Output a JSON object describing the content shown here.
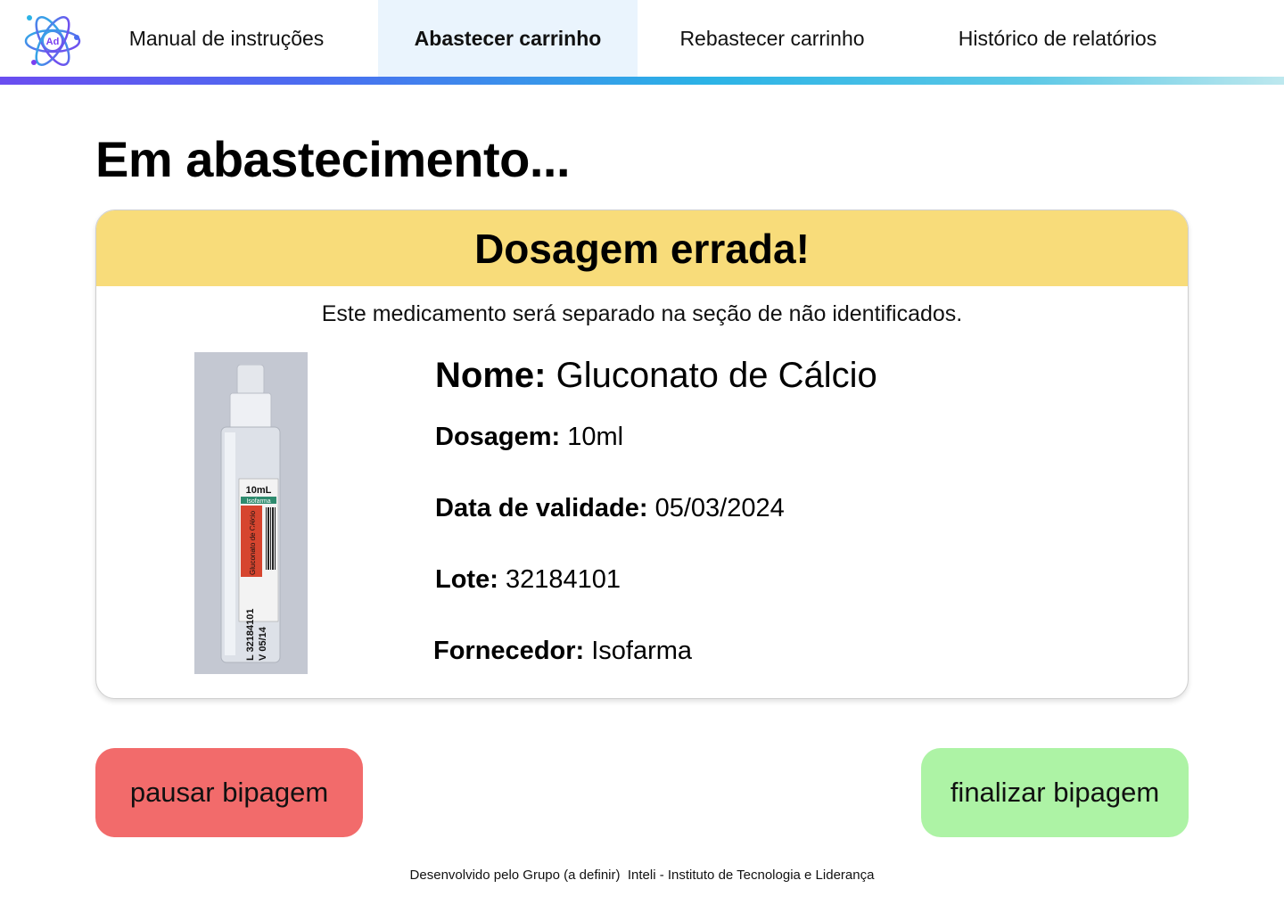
{
  "nav": {
    "logo_text": "Ad",
    "items": [
      {
        "label": "Manual de instruções",
        "active": false
      },
      {
        "label": "Abastecer carrinho",
        "active": true
      },
      {
        "label": "Rebastecer carrinho",
        "active": false
      },
      {
        "label": "Histórico de relatórios",
        "active": false
      }
    ]
  },
  "page": {
    "title": "Em abastecimento..."
  },
  "alert": {
    "title": "Dosagem errada!",
    "message": "Este medicamento será separado na seção de não identificados.",
    "header_color": "#f8dc7a"
  },
  "medication": {
    "name_label": "Nome:",
    "name": "Gluconato de Cálcio",
    "dose_label": "Dosagem:",
    "dose": "10ml",
    "expiry_label": "Data de validade:",
    "expiry": "05/03/2024",
    "lot_label": "Lote:",
    "lot": "32184101",
    "supplier_label": "Fornecedor:",
    "supplier": "Isofarma",
    "image_label": {
      "volume": "10mL",
      "brand": "Isofarma",
      "percent": "10%",
      "drug": "Gluconato de Cálcio",
      "lot_print": "L 32184101",
      "validity_print": "V 05/14"
    }
  },
  "actions": {
    "pause_label": "pausar bipagem",
    "finish_label": "finalizar bipagem",
    "pause_color": "#f26b6b",
    "finish_color": "#adf3a5"
  },
  "footer": {
    "left": "Desenvolvido pelo Grupo (a definir)",
    "right": "Inteli - Instituto de Tecnologia e Liderança"
  }
}
